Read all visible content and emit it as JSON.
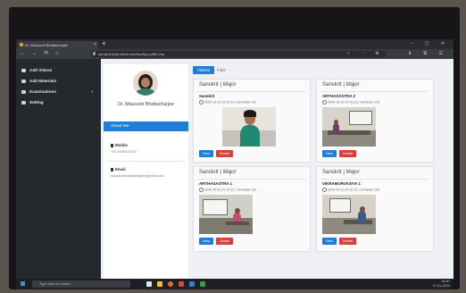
{
  "browser": {
    "tab_title": "Dr. Mausumi Bhattacharjee",
    "tab_close": "×",
    "new_tab": "+",
    "window_controls": "–  ▢  ✕",
    "nav_buttons": "←  →  ⟳  ⌂",
    "url": "sanskrit-dept.mkhs.edu/faculty-profile.php",
    "address_icons": "☆  ⋯  ⊕",
    "toolbar_icons": "⬇  ⧉  ☰"
  },
  "sidebar": {
    "items": [
      {
        "label": "Add Videos",
        "icon": "video-icon"
      },
      {
        "label": "Add Materials",
        "icon": "file-icon"
      },
      {
        "label": "Examinations",
        "icon": "exam-icon",
        "chevron": "›"
      },
      {
        "label": "Setting",
        "icon": "gear-icon"
      }
    ]
  },
  "profile": {
    "name": "Dr. Mausumi Bhattacharjee",
    "about_label": "About Me",
    "mobile_label": "Mobile",
    "mobile_value": "+91 9436371200",
    "email_label": "Email",
    "email_value": "mausumibhattacharjee@gmail.com"
  },
  "tabs": {
    "videos": "Videos",
    "other": "Files"
  },
  "cards": [
    {
      "subject": "Sanskrit",
      "level": "Major",
      "title": "Sanskrit",
      "meta": "2020-10-12 07:10:12 | Semester 3rd",
      "view": "View",
      "delete": "Delete"
    },
    {
      "subject": "Sanskrit",
      "level": "Major",
      "title": "ARTHASASTRA 2",
      "meta": "2020-10-12 07:10:12 | Semester 3rd",
      "view": "View",
      "delete": "Delete"
    },
    {
      "subject": "Sanskrit",
      "level": "Major",
      "title": "ARTHASASTRA 1",
      "meta": "2020-10-12 07:10:12 | Semester 3rd",
      "view": "View",
      "delete": "Delete"
    },
    {
      "subject": "Sanskrit",
      "level": "Major",
      "title": "VIKRAMORVASIYA 1",
      "meta": "2020-10-12 07:10:12 | Semester 3rd",
      "view": "View",
      "delete": "Delete"
    }
  ],
  "taskbar": {
    "search_placeholder": "Type here to search",
    "time": "16:57",
    "date": "27-01-2021"
  },
  "colors": {
    "primary": "#1f7ed6",
    "danger": "#d9403b",
    "sidebar": "#24292e"
  }
}
